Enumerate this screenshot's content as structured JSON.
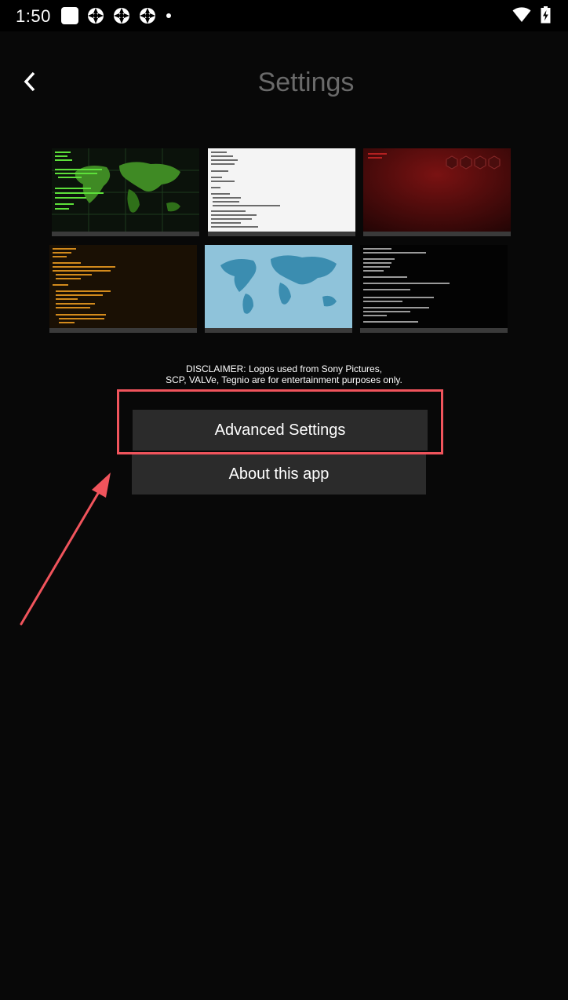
{
  "status_bar": {
    "time": "1:50",
    "icons": [
      "notification-square-icon",
      "app-badge-icon",
      "app-badge-icon",
      "app-badge-icon",
      "more-dot-icon",
      "wifi-icon",
      "battery-icon"
    ]
  },
  "header": {
    "back_icon": "chevron-left-icon",
    "title": "Settings"
  },
  "themes": [
    {
      "name": "theme-green-world-map"
    },
    {
      "name": "theme-white-code"
    },
    {
      "name": "theme-red-hexagons"
    },
    {
      "name": "theme-orange-code"
    },
    {
      "name": "theme-blue-world-map"
    },
    {
      "name": "theme-black-terminal"
    }
  ],
  "disclaimer": {
    "line1": "DISCLAIMER: Logos used from Sony Pictures,",
    "line2": "SCP, VALVe, Tegnio are for entertainment purposes only."
  },
  "menu": {
    "advanced_settings": "Advanced Settings",
    "about_app": "About this app"
  },
  "colors": {
    "background": "#080808",
    "button": "#2b2b2b",
    "title": "#6a6a6a",
    "annotation": "#f0545c"
  }
}
